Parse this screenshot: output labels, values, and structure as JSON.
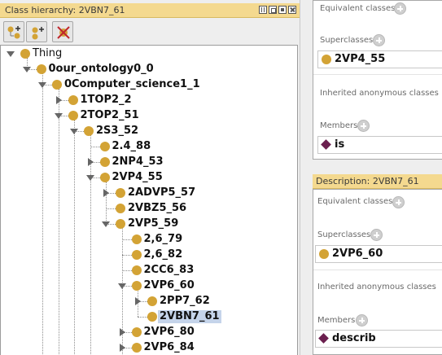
{
  "left_panel": {
    "title": "Class hierarchy: 2VBN7_61",
    "toolbar": {
      "buttons": [
        {
          "icon": "add-subclass-icon"
        },
        {
          "icon": "add-sibling-class-icon"
        },
        {
          "icon": "delete-class-icon"
        }
      ]
    },
    "tree": {
      "nodes": [
        {
          "label": "Thing",
          "toggle": "open",
          "bold": false
        },
        {
          "label": "0our_ontology0_0",
          "toggle": "open",
          "bold": true
        },
        {
          "label": "0Computer_science1_1",
          "toggle": "open",
          "bold": true
        },
        {
          "label": "1TOP2_2",
          "toggle": "closed",
          "bold": true
        },
        {
          "label": "2TOP2_51",
          "toggle": "open",
          "bold": true
        },
        {
          "label": "2S3_52",
          "toggle": "open",
          "bold": true
        },
        {
          "label": "2.4_88",
          "toggle": "none",
          "bold": true
        },
        {
          "label": "2NP4_53",
          "toggle": "closed",
          "bold": true
        },
        {
          "label": "2VP4_55",
          "toggle": "open",
          "bold": true
        },
        {
          "label": "2ADVP5_57",
          "toggle": "closed",
          "bold": true
        },
        {
          "label": "2VBZ5_56",
          "toggle": "none",
          "bold": true
        },
        {
          "label": "2VP5_59",
          "toggle": "open",
          "bold": true
        },
        {
          "label": "2,6_79",
          "toggle": "none",
          "bold": true
        },
        {
          "label": "2,6_82",
          "toggle": "none",
          "bold": true
        },
        {
          "label": "2CC6_83",
          "toggle": "none",
          "bold": true
        },
        {
          "label": "2VP6_60",
          "toggle": "open",
          "bold": true
        },
        {
          "label": "2PP7_62",
          "toggle": "closed",
          "bold": true
        },
        {
          "label": "2VBN7_61",
          "toggle": "none",
          "bold": true,
          "selected": true
        },
        {
          "label": "2VP6_80",
          "toggle": "closed",
          "bold": true
        },
        {
          "label": "2VP6_84",
          "toggle": "closed",
          "bold": true
        }
      ]
    }
  },
  "top_right_panel": {
    "equivalent_classes_label": "Equivalent classes",
    "superclasses_label": "Superclasses",
    "superclass_value": "2VP4_55",
    "inherited_label": "Inherited anonymous classes",
    "members_label": "Members",
    "member_value": "is"
  },
  "bottom_right_panel": {
    "title": "Description: 2VBN7_61",
    "equivalent_classes_label": "Equivalent classes",
    "superclasses_label": "Superclasses",
    "superclass_value": "2VP6_60",
    "inherited_label": "Inherited anonymous classes",
    "members_label": "Members",
    "member_value": "describ"
  },
  "colors": {
    "class_dot": "#d3a335",
    "individual_diamond": "#6b1f4f",
    "title_bar": "#f4d98f",
    "selection": "#c5d4ea"
  }
}
